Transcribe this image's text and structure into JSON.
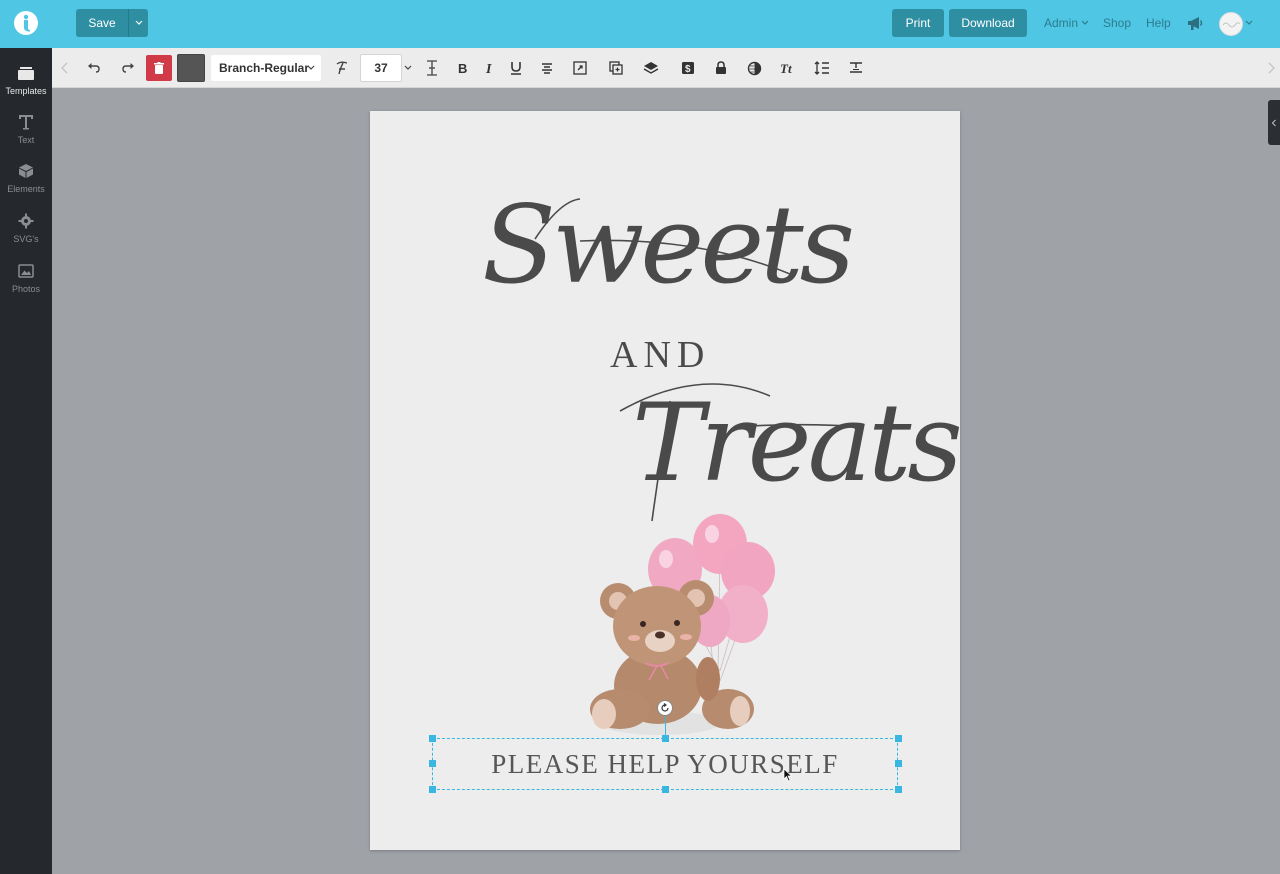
{
  "header": {
    "save_label": "Save",
    "print_label": "Print",
    "download_label": "Download",
    "admin_label": "Admin",
    "shop_label": "Shop",
    "help_label": "Help"
  },
  "sidebar": {
    "items": [
      {
        "label": "Templates",
        "icon": "templates-icon",
        "active": true
      },
      {
        "label": "Text",
        "icon": "text-icon",
        "active": false
      },
      {
        "label": "Elements",
        "icon": "elements-icon",
        "active": false
      },
      {
        "label": "SVG's",
        "icon": "gear-icon",
        "active": false
      },
      {
        "label": "Photos",
        "icon": "photos-icon",
        "active": false
      }
    ]
  },
  "toolbar": {
    "font_name": "Branch-Regular",
    "font_size": "37",
    "text_color": "#555555",
    "delete_color": "#d13b47"
  },
  "canvas": {
    "title_line1": "Sweets",
    "title_and": "AND",
    "title_line2": "Treats",
    "footer_text": "PLEASE HELP YOURSELF"
  },
  "colors": {
    "header_bg": "#4ec6e4",
    "button_teal": "#2e8fa3",
    "sidebar_bg": "#25282c",
    "selection": "#3ab7e0"
  }
}
